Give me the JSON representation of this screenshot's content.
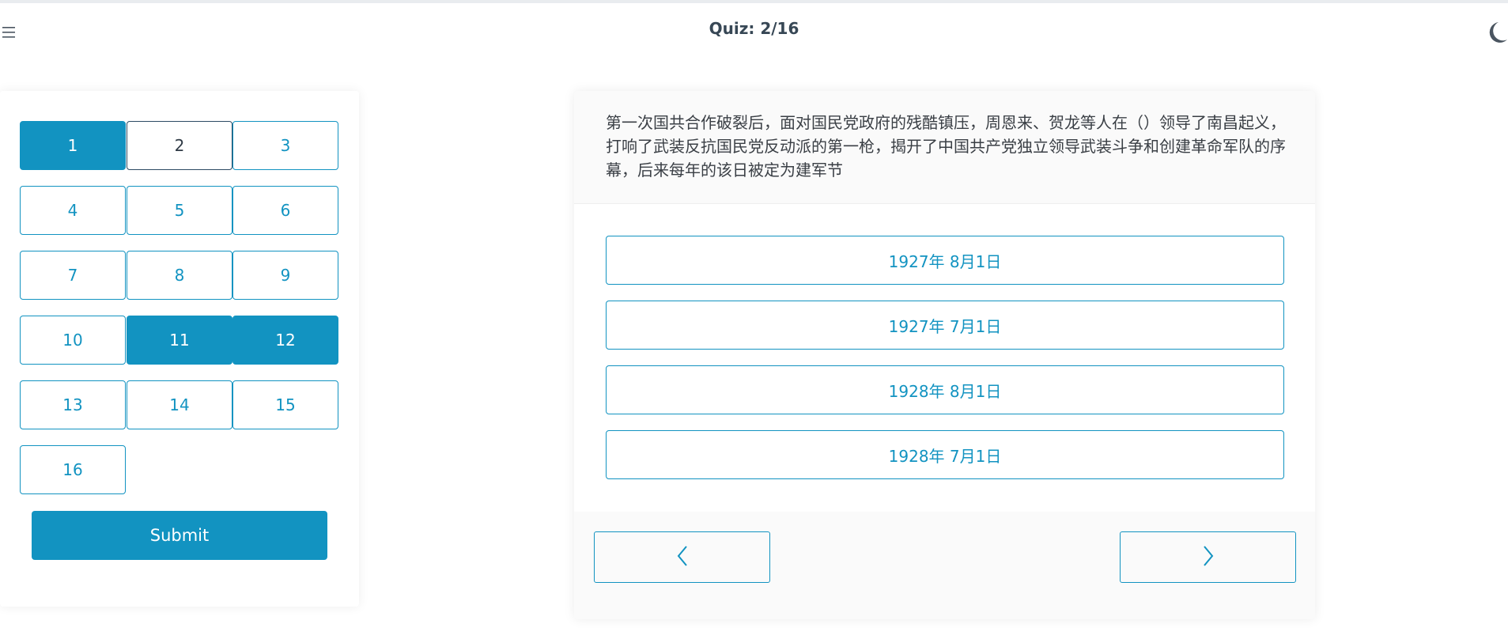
{
  "header": {
    "title": "Quiz: 2/16",
    "menu_icon": "hamburger-menu-icon",
    "theme_icon": "moon-icon"
  },
  "navigator": {
    "questions": [
      {
        "label": "1",
        "state": "answered"
      },
      {
        "label": "2",
        "state": "current"
      },
      {
        "label": "3",
        "state": "unanswered"
      },
      {
        "label": "4",
        "state": "unanswered"
      },
      {
        "label": "5",
        "state": "unanswered"
      },
      {
        "label": "6",
        "state": "unanswered"
      },
      {
        "label": "7",
        "state": "unanswered"
      },
      {
        "label": "8",
        "state": "unanswered"
      },
      {
        "label": "9",
        "state": "unanswered"
      },
      {
        "label": "10",
        "state": "unanswered"
      },
      {
        "label": "11",
        "state": "answered"
      },
      {
        "label": "12",
        "state": "answered"
      },
      {
        "label": "13",
        "state": "unanswered"
      },
      {
        "label": "14",
        "state": "unanswered"
      },
      {
        "label": "15",
        "state": "unanswered"
      },
      {
        "label": "16",
        "state": "unanswered"
      }
    ],
    "submit_label": "Submit"
  },
  "quiz": {
    "question": "第一次国共合作破裂后，面对国民党政府的残酷镇压，周恩来、贺龙等人在（）领导了南昌起义，打响了武装反抗国民党反动派的第一枪，揭开了中国共产党独立领导武装斗争和创建革命军队的序幕，后来每年的该日被定为建军节",
    "options": [
      "1927年 8月1日",
      "1927年 7月1日",
      "1928年 8月1日",
      "1928年 7月1日"
    ],
    "prev_icon": "chevron-left-icon",
    "next_icon": "chevron-right-icon"
  },
  "colors": {
    "accent": "#1293c1",
    "title_text": "#374755",
    "body_text": "#3a3f45",
    "current_border": "#2c4a63"
  }
}
